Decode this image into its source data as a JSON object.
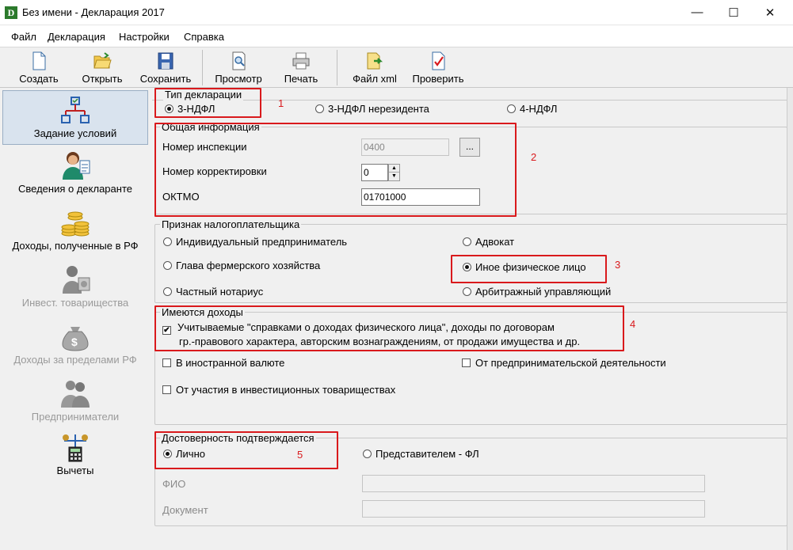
{
  "window": {
    "title": "Без имени - Декларация 2017",
    "app_icon": "D",
    "minimize": "—",
    "maximize": "☐",
    "close": "✕"
  },
  "menu": [
    "Файл",
    "Декларация",
    "Настройки",
    "Справка"
  ],
  "toolbar": {
    "create": "Создать",
    "open": "Открыть",
    "save": "Сохранить",
    "preview": "Просмотр",
    "print": "Печать",
    "xml": "Файл xml",
    "check": "Проверить"
  },
  "sidebar": {
    "items": [
      {
        "label": "Задание условий",
        "icon": "diagram-icon"
      },
      {
        "label": "Сведения о декларанте",
        "icon": "person-icon"
      },
      {
        "label": "Доходы, полученные в РФ",
        "icon": "coins-icon"
      },
      {
        "label": "Инвест. товарищества",
        "icon": "investor-icon"
      },
      {
        "label": "Доходы за пределами РФ",
        "icon": "money-bag-icon"
      },
      {
        "label": "Предприниматели",
        "icon": "businessmen-icon"
      },
      {
        "label": "Вычеты",
        "icon": "calculator-scale-icon"
      }
    ]
  },
  "decl_type": {
    "legend": "Тип декларации",
    "options": [
      "3-НДФЛ",
      "3-НДФЛ нерезидента",
      "4-НДФЛ"
    ],
    "selected": "3-НДФЛ"
  },
  "general": {
    "legend": "Общая информация",
    "inspection_label": "Номер инспекции",
    "inspection_value": "0400",
    "browse": "...",
    "correction_label": "Номер корректировки",
    "correction_value": "0",
    "oktmo_label": "ОКТМО",
    "oktmo_value": "01701000"
  },
  "taxpayer": {
    "legend": "Признак налогоплательщика",
    "options": [
      "Индивидуальный предприниматель",
      "Адвокат",
      "Глава фермерского хозяйства",
      "Иное физическое лицо",
      "Частный нотариус",
      "Арбитражный управляющий"
    ],
    "selected": "Иное физическое лицо"
  },
  "income": {
    "legend": "Имеются доходы",
    "main_line1": "Учитываемые \"справками о доходах физического лица\", доходы по договорам",
    "main_line2": "гр.-правового характера, авторским вознаграждениям, от продажи имущества и др.",
    "foreign": "В иностранной валюте",
    "business": "От предпринимательской деятельности",
    "invest": "От участия в инвестиционных товариществах",
    "checkmark": "✔"
  },
  "confirm": {
    "legend": "Достоверность подтверждается",
    "personal": "Лично",
    "representative": "Представителем - ФЛ",
    "fio_label": "ФИО",
    "doc_label": "Документ"
  },
  "annotations": [
    "1",
    "2",
    "3",
    "4",
    "5"
  ],
  "colors": {
    "annotation_red": "#d9191c",
    "sidebar_active": "#d9e3ee"
  }
}
